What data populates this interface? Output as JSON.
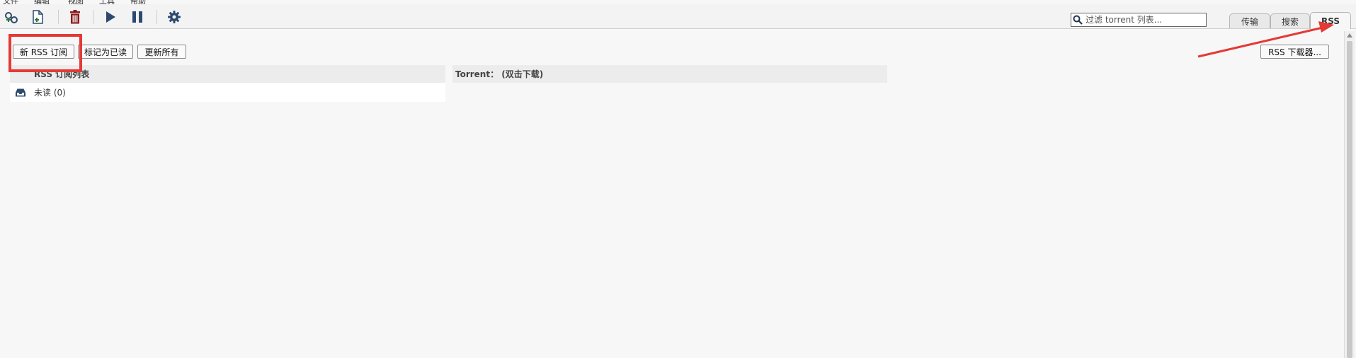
{
  "menubar": {
    "items": [
      "文件",
      "编辑",
      "视图",
      "工具",
      "帮助"
    ]
  },
  "toolbar": {
    "buttons": [
      {
        "name": "add-torrent-link-icon",
        "color": "#2e7d32"
      },
      {
        "name": "add-torrent-file-icon",
        "color": "#2e7d32"
      },
      {
        "name": "delete-icon",
        "color": "#8b1a1a"
      },
      {
        "name": "resume-icon",
        "color": "#2c4a6e"
      },
      {
        "name": "pause-icon",
        "color": "#2c4a6e"
      },
      {
        "name": "options-gear-icon",
        "color": "#2c4a6e"
      }
    ]
  },
  "search": {
    "placeholder": "过滤 torrent 列表...",
    "value": ""
  },
  "tabs": [
    {
      "label": "传输",
      "active": false
    },
    {
      "label": "搜索",
      "active": false
    },
    {
      "label": "RSS",
      "active": true
    }
  ],
  "rss": {
    "new_subscription_label": "新 RSS 订阅",
    "mark_read_label": "标记为已读",
    "update_all_label": "更新所有",
    "downloader_label": "RSS 下载器...",
    "feeds_header": "RSS 订阅列表",
    "torrents_header": "Torrent： (双击下载)",
    "feeds": [
      {
        "label": "未读 (0)",
        "icon": "inbox-icon"
      }
    ]
  },
  "annotation": {
    "highlight_color": "#e53935"
  }
}
